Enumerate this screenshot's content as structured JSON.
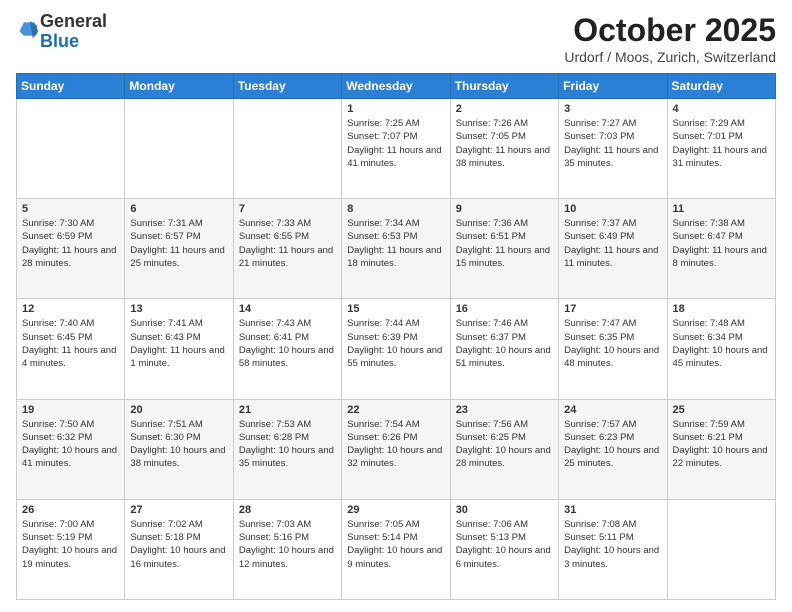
{
  "logo": {
    "general": "General",
    "blue": "Blue"
  },
  "header": {
    "month": "October 2025",
    "location": "Urdorf / Moos, Zurich, Switzerland"
  },
  "weekdays": [
    "Sunday",
    "Monday",
    "Tuesday",
    "Wednesday",
    "Thursday",
    "Friday",
    "Saturday"
  ],
  "weeks": [
    [
      {
        "day": "",
        "sunrise": "",
        "sunset": "",
        "daylight": ""
      },
      {
        "day": "",
        "sunrise": "",
        "sunset": "",
        "daylight": ""
      },
      {
        "day": "",
        "sunrise": "",
        "sunset": "",
        "daylight": ""
      },
      {
        "day": "1",
        "sunrise": "Sunrise: 7:25 AM",
        "sunset": "Sunset: 7:07 PM",
        "daylight": "Daylight: 11 hours and 41 minutes."
      },
      {
        "day": "2",
        "sunrise": "Sunrise: 7:26 AM",
        "sunset": "Sunset: 7:05 PM",
        "daylight": "Daylight: 11 hours and 38 minutes."
      },
      {
        "day": "3",
        "sunrise": "Sunrise: 7:27 AM",
        "sunset": "Sunset: 7:03 PM",
        "daylight": "Daylight: 11 hours and 35 minutes."
      },
      {
        "day": "4",
        "sunrise": "Sunrise: 7:29 AM",
        "sunset": "Sunset: 7:01 PM",
        "daylight": "Daylight: 11 hours and 31 minutes."
      }
    ],
    [
      {
        "day": "5",
        "sunrise": "Sunrise: 7:30 AM",
        "sunset": "Sunset: 6:59 PM",
        "daylight": "Daylight: 11 hours and 28 minutes."
      },
      {
        "day": "6",
        "sunrise": "Sunrise: 7:31 AM",
        "sunset": "Sunset: 6:57 PM",
        "daylight": "Daylight: 11 hours and 25 minutes."
      },
      {
        "day": "7",
        "sunrise": "Sunrise: 7:33 AM",
        "sunset": "Sunset: 6:55 PM",
        "daylight": "Daylight: 11 hours and 21 minutes."
      },
      {
        "day": "8",
        "sunrise": "Sunrise: 7:34 AM",
        "sunset": "Sunset: 6:53 PM",
        "daylight": "Daylight: 11 hours and 18 minutes."
      },
      {
        "day": "9",
        "sunrise": "Sunrise: 7:36 AM",
        "sunset": "Sunset: 6:51 PM",
        "daylight": "Daylight: 11 hours and 15 minutes."
      },
      {
        "day": "10",
        "sunrise": "Sunrise: 7:37 AM",
        "sunset": "Sunset: 6:49 PM",
        "daylight": "Daylight: 11 hours and 11 minutes."
      },
      {
        "day": "11",
        "sunrise": "Sunrise: 7:38 AM",
        "sunset": "Sunset: 6:47 PM",
        "daylight": "Daylight: 11 hours and 8 minutes."
      }
    ],
    [
      {
        "day": "12",
        "sunrise": "Sunrise: 7:40 AM",
        "sunset": "Sunset: 6:45 PM",
        "daylight": "Daylight: 11 hours and 4 minutes."
      },
      {
        "day": "13",
        "sunrise": "Sunrise: 7:41 AM",
        "sunset": "Sunset: 6:43 PM",
        "daylight": "Daylight: 11 hours and 1 minute."
      },
      {
        "day": "14",
        "sunrise": "Sunrise: 7:43 AM",
        "sunset": "Sunset: 6:41 PM",
        "daylight": "Daylight: 10 hours and 58 minutes."
      },
      {
        "day": "15",
        "sunrise": "Sunrise: 7:44 AM",
        "sunset": "Sunset: 6:39 PM",
        "daylight": "Daylight: 10 hours and 55 minutes."
      },
      {
        "day": "16",
        "sunrise": "Sunrise: 7:46 AM",
        "sunset": "Sunset: 6:37 PM",
        "daylight": "Daylight: 10 hours and 51 minutes."
      },
      {
        "day": "17",
        "sunrise": "Sunrise: 7:47 AM",
        "sunset": "Sunset: 6:35 PM",
        "daylight": "Daylight: 10 hours and 48 minutes."
      },
      {
        "day": "18",
        "sunrise": "Sunrise: 7:48 AM",
        "sunset": "Sunset: 6:34 PM",
        "daylight": "Daylight: 10 hours and 45 minutes."
      }
    ],
    [
      {
        "day": "19",
        "sunrise": "Sunrise: 7:50 AM",
        "sunset": "Sunset: 6:32 PM",
        "daylight": "Daylight: 10 hours and 41 minutes."
      },
      {
        "day": "20",
        "sunrise": "Sunrise: 7:51 AM",
        "sunset": "Sunset: 6:30 PM",
        "daylight": "Daylight: 10 hours and 38 minutes."
      },
      {
        "day": "21",
        "sunrise": "Sunrise: 7:53 AM",
        "sunset": "Sunset: 6:28 PM",
        "daylight": "Daylight: 10 hours and 35 minutes."
      },
      {
        "day": "22",
        "sunrise": "Sunrise: 7:54 AM",
        "sunset": "Sunset: 6:26 PM",
        "daylight": "Daylight: 10 hours and 32 minutes."
      },
      {
        "day": "23",
        "sunrise": "Sunrise: 7:56 AM",
        "sunset": "Sunset: 6:25 PM",
        "daylight": "Daylight: 10 hours and 28 minutes."
      },
      {
        "day": "24",
        "sunrise": "Sunrise: 7:57 AM",
        "sunset": "Sunset: 6:23 PM",
        "daylight": "Daylight: 10 hours and 25 minutes."
      },
      {
        "day": "25",
        "sunrise": "Sunrise: 7:59 AM",
        "sunset": "Sunset: 6:21 PM",
        "daylight": "Daylight: 10 hours and 22 minutes."
      }
    ],
    [
      {
        "day": "26",
        "sunrise": "Sunrise: 7:00 AM",
        "sunset": "Sunset: 5:19 PM",
        "daylight": "Daylight: 10 hours and 19 minutes."
      },
      {
        "day": "27",
        "sunrise": "Sunrise: 7:02 AM",
        "sunset": "Sunset: 5:18 PM",
        "daylight": "Daylight: 10 hours and 16 minutes."
      },
      {
        "day": "28",
        "sunrise": "Sunrise: 7:03 AM",
        "sunset": "Sunset: 5:16 PM",
        "daylight": "Daylight: 10 hours and 12 minutes."
      },
      {
        "day": "29",
        "sunrise": "Sunrise: 7:05 AM",
        "sunset": "Sunset: 5:14 PM",
        "daylight": "Daylight: 10 hours and 9 minutes."
      },
      {
        "day": "30",
        "sunrise": "Sunrise: 7:06 AM",
        "sunset": "Sunset: 5:13 PM",
        "daylight": "Daylight: 10 hours and 6 minutes."
      },
      {
        "day": "31",
        "sunrise": "Sunrise: 7:08 AM",
        "sunset": "Sunset: 5:11 PM",
        "daylight": "Daylight: 10 hours and 3 minutes."
      },
      {
        "day": "",
        "sunrise": "",
        "sunset": "",
        "daylight": ""
      }
    ]
  ]
}
